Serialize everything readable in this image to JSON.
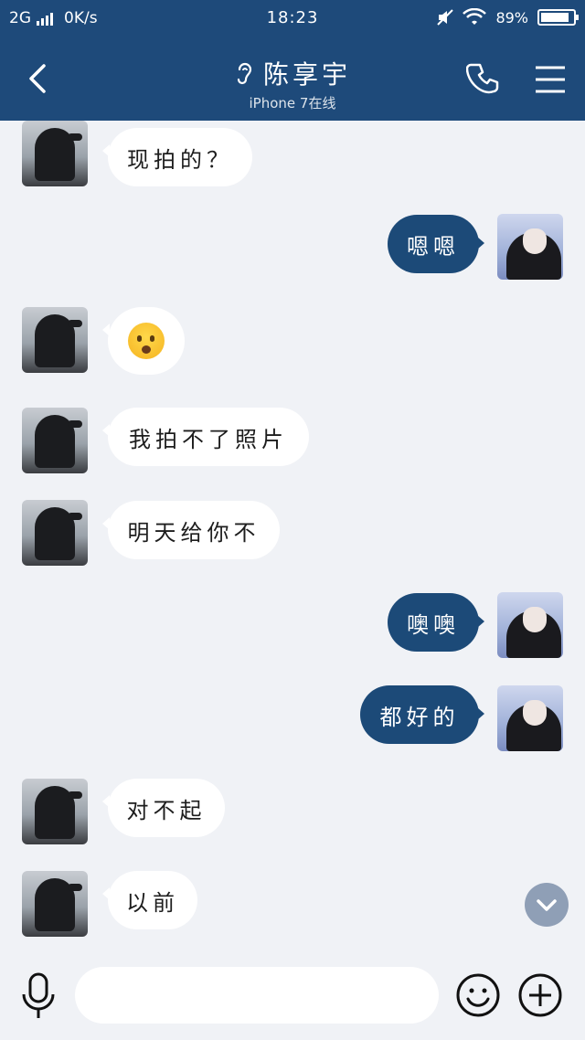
{
  "status_bar": {
    "network": "2G",
    "speed": "0K/s",
    "time": "18:23",
    "battery": "89"
  },
  "header": {
    "title": "陈享宇",
    "subtitle": "iPhone 7在线",
    "icons": [
      "back-arrow-icon",
      "ear-icon",
      "phone-icon",
      "menu-icon"
    ]
  },
  "messages": [
    {
      "side": "left",
      "type": "text",
      "text": "现拍的？"
    },
    {
      "side": "right",
      "type": "text",
      "text": "嗯嗯"
    },
    {
      "side": "left",
      "type": "emoji",
      "emoji": "😱",
      "icon": "scared-face-emoji-icon"
    },
    {
      "side": "left",
      "type": "text",
      "text": "我拍不了照片"
    },
    {
      "side": "left",
      "type": "text",
      "text": "明天给你不"
    },
    {
      "side": "right",
      "type": "text",
      "text": "噢噢"
    },
    {
      "side": "right",
      "type": "text",
      "text": "都好的"
    },
    {
      "side": "left",
      "type": "text",
      "text": "对不起"
    },
    {
      "side": "left",
      "type": "text",
      "text": "以前"
    }
  ],
  "input_bar": {
    "value": "",
    "icons": [
      "microphone-icon",
      "smiley-icon",
      "plus-icon"
    ]
  },
  "colors": {
    "header_bg": "#1e4a7a",
    "sent_bubble": "#1c4a78",
    "received_bubble": "#ffffff",
    "chat_bg": "#f0f2f6"
  }
}
